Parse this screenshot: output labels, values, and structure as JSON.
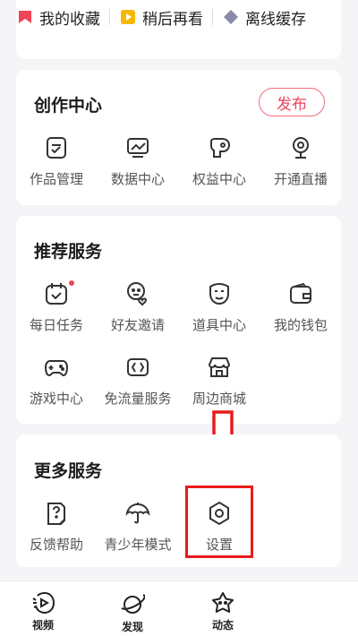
{
  "quick_bar": {
    "items": [
      {
        "label": "我的收藏",
        "icon": "favorites-icon"
      },
      {
        "label": "稍后再看",
        "icon": "watch-later-icon"
      },
      {
        "label": "离线缓存",
        "icon": "offline-cache-icon"
      }
    ]
  },
  "creation_center": {
    "title": "创作中心",
    "publish_label": "发布",
    "items": [
      {
        "label": "作品管理",
        "icon": "works-management-icon"
      },
      {
        "label": "数据中心",
        "icon": "data-center-icon"
      },
      {
        "label": "权益中心",
        "icon": "benefits-center-icon"
      },
      {
        "label": "开通直播",
        "icon": "start-live-icon"
      }
    ]
  },
  "recommended_services": {
    "title": "推荐服务",
    "items": [
      {
        "label": "每日任务",
        "icon": "daily-tasks-icon",
        "badge_dot": true
      },
      {
        "label": "好友邀请",
        "icon": "friend-invite-icon"
      },
      {
        "label": "道具中心",
        "icon": "props-center-icon"
      },
      {
        "label": "我的钱包",
        "icon": "wallet-icon"
      },
      {
        "label": "游戏中心",
        "icon": "game-center-icon"
      },
      {
        "label": "免流量服务",
        "icon": "free-data-icon"
      },
      {
        "label": "周边商城",
        "icon": "merch-store-icon"
      }
    ]
  },
  "more_services": {
    "title": "更多服务",
    "items": [
      {
        "label": "反馈帮助",
        "icon": "feedback-help-icon"
      },
      {
        "label": "青少年模式",
        "icon": "youth-mode-icon"
      },
      {
        "label": "设置",
        "icon": "settings-icon"
      }
    ]
  },
  "bottom_nav": {
    "items": [
      {
        "label": "视频",
        "icon": "video-icon"
      },
      {
        "label": "发现",
        "icon": "discover-icon"
      },
      {
        "label": "动态",
        "icon": "moments-icon"
      }
    ]
  },
  "colors": {
    "accent": "#e8455d",
    "highlight": "#e81c1c",
    "background": "#f5f5f7"
  }
}
